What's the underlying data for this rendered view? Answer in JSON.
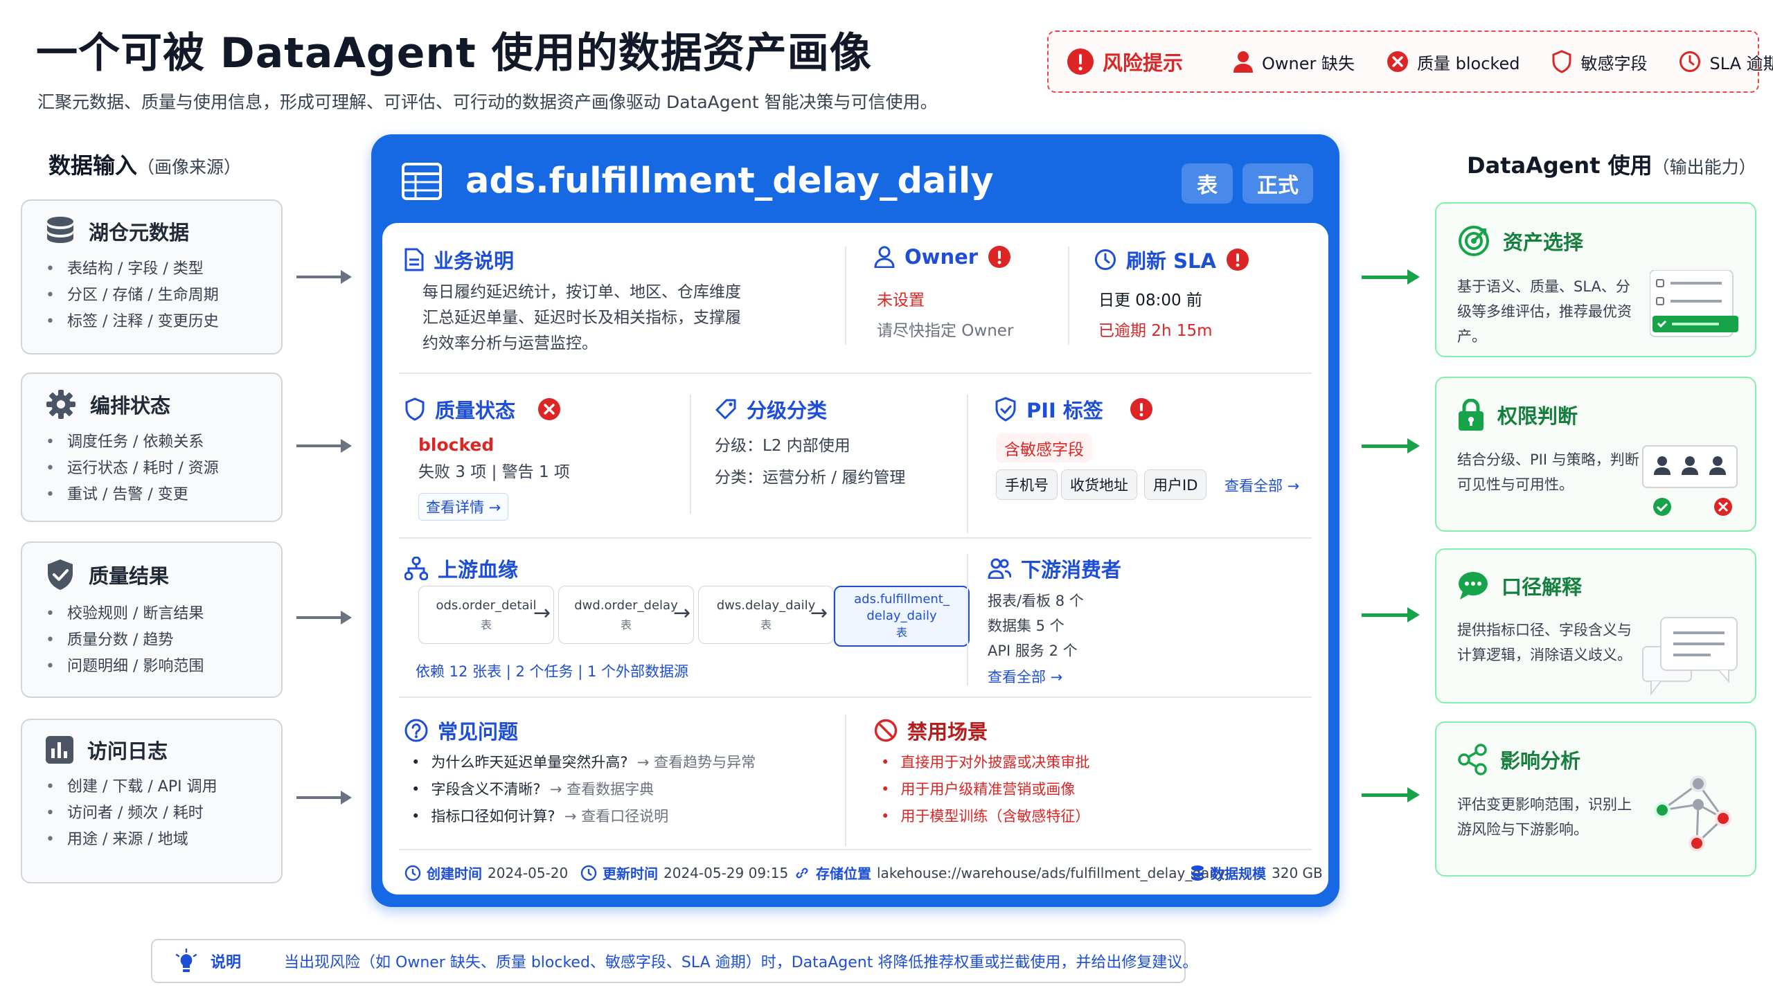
{
  "title": "一个可被 DataAgent 使用的数据资产画像",
  "subtitle": "汇聚元数据、质量与使用信息，形成可理解、可评估、可行动的数据资产画像驱动 DataAgent 智能决策与可信使用。",
  "risk_bar": {
    "label": "风险提示",
    "items": [
      "Owner 缺失",
      "质量 blocked",
      "敏感字段",
      "SLA 逾期"
    ]
  },
  "input_column": {
    "title": "数据输入",
    "note": "（画像来源）",
    "cards": [
      {
        "icon": "database-icon",
        "title": "湖仓元数据",
        "items": [
          "表结构 / 字段 / 类型",
          "分区 / 存储 / 生命周期",
          "标签 / 注释 / 变更历史"
        ]
      },
      {
        "icon": "gear-icon",
        "title": "编排状态",
        "items": [
          "调度任务 / 依赖关系",
          "运行状态 / 耗时 / 资源",
          "重试 / 告警 / 变更"
        ]
      },
      {
        "icon": "shield-check-icon",
        "title": "质量结果",
        "items": [
          "校验规则 / 断言结果",
          "质量分数 / 趋势",
          "问题明细 / 影响范围"
        ]
      },
      {
        "icon": "bar-chart-icon",
        "title": "访问日志",
        "items": [
          "创建 / 下载 / API 调用",
          "访问者 / 频次 / 耗时",
          "用途 / 来源 / 地域"
        ]
      }
    ]
  },
  "output_column": {
    "title": "DataAgent 使用",
    "note": "（输出能力）",
    "cards": [
      {
        "icon": "target-icon",
        "title": "资产选择",
        "desc": "基于语义、质量、SLA、分级等多维评估，推荐最优资产。"
      },
      {
        "icon": "lock-icon",
        "title": "权限判断",
        "desc": "结合分级、PII 与策略，判断可见性与可用性。"
      },
      {
        "icon": "chat-icon",
        "title": "口径解释",
        "desc": "提供指标口径、字段含义与计算逻辑，消除语义歧义。"
      },
      {
        "icon": "share-icon",
        "title": "影响分析",
        "desc": "评估变更影响范围，识别上游风险与下游影响。"
      }
    ]
  },
  "asset": {
    "name": "ads.fulfillment_delay_daily",
    "tags": [
      "表",
      "正式"
    ],
    "business": {
      "title": "业务说明",
      "lines": [
        "每日履约延迟统计，按订单、地区、仓库维度",
        "汇总延迟单量、延迟时长及相关指标，支撑履",
        "约效率分析与运营监控。"
      ]
    },
    "owner": {
      "title": "Owner",
      "status": "未设置",
      "hint": "请尽快指定 Owner"
    },
    "sla": {
      "title": "刷新 SLA",
      "schedule": "日更 08:00 前",
      "status": "已逾期 2h 15m"
    },
    "quality": {
      "title": "质量状态",
      "status": "blocked",
      "detail": "失败 3 项 | 警告 1 项",
      "link": "查看详情 →"
    },
    "classification": {
      "title": "分级分类",
      "level": "分级：L2 内部使用",
      "category": "分类：运营分析 / 履约管理"
    },
    "pii": {
      "title": "PII 标签",
      "badge": "含敏感字段",
      "chips": [
        "手机号",
        "收货地址",
        "用户ID"
      ],
      "link": "查看全部 →"
    },
    "lineage": {
      "title": "上游血缘",
      "nodes": [
        {
          "name": "ods.order_detail",
          "type": "表"
        },
        {
          "name": "dwd.order_delay",
          "type": "表"
        },
        {
          "name": "dws.delay_daily",
          "type": "表"
        },
        {
          "name_line1": "ads.fulfillment_",
          "name_line2": "delay_daily",
          "type": "表"
        }
      ],
      "summary": "依赖 12 张表 | 2 个任务 | 1 个外部数据源"
    },
    "consumers": {
      "title": "下游消费者",
      "lines": [
        "报表/看板 8 个",
        "数据集 5 个",
        "API 服务 2 个"
      ],
      "link": "查看全部 →"
    },
    "faq": {
      "title": "常见问题",
      "items": [
        {
          "q": "为什么昨天延迟单量突然升高?",
          "a": "查看趋势与异常"
        },
        {
          "q": "字段含义不清晰?",
          "a": "查看数据字典"
        },
        {
          "q": "指标口径如何计算?",
          "a": "查看口径说明"
        }
      ]
    },
    "forbidden": {
      "title": "禁用场景",
      "items": [
        "直接用于对外披露或决策审批",
        "用于用户级精准营销或画像",
        "用于模型训练（含敏感特征）"
      ]
    },
    "meta": {
      "created_label": "创建时间",
      "created": "2024-05-20",
      "updated_label": "更新时间",
      "updated": "2024-05-29 09:15",
      "location_label": "存储位置",
      "location": "lakehouse://warehouse/ads/fulfillment_delay_daily",
      "size_label": "数据规模",
      "size": "320 GB"
    }
  },
  "note": {
    "label": "说明",
    "text": "当出现风险（如 Owner 缺失、质量 blocked、敏感字段、SLA 逾期）时，DataAgent 将降低推荐权重或拦截使用，并给出修复建议。"
  },
  "colors": {
    "primary": "#1668e3",
    "danger": "#dc2626",
    "success": "#16a34a"
  }
}
